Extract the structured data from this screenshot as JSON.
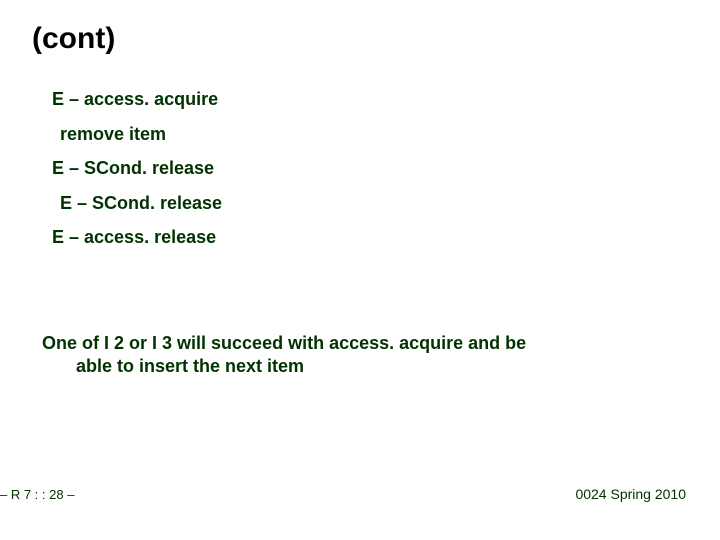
{
  "title": "(cont)",
  "lines": {
    "l0": "E – access. acquire",
    "l1": "remove item",
    "l2": "E – SCond. release",
    "l3": "E – SCond. release",
    "l4": "E – access. release"
  },
  "paragraph": {
    "line1": "One of I 2 or I 3 will succeed with access. acquire and be",
    "line2": "able to insert the next item"
  },
  "footer": {
    "left": "– R 7 : :  28 –",
    "right": "0024 Spring 2010"
  }
}
